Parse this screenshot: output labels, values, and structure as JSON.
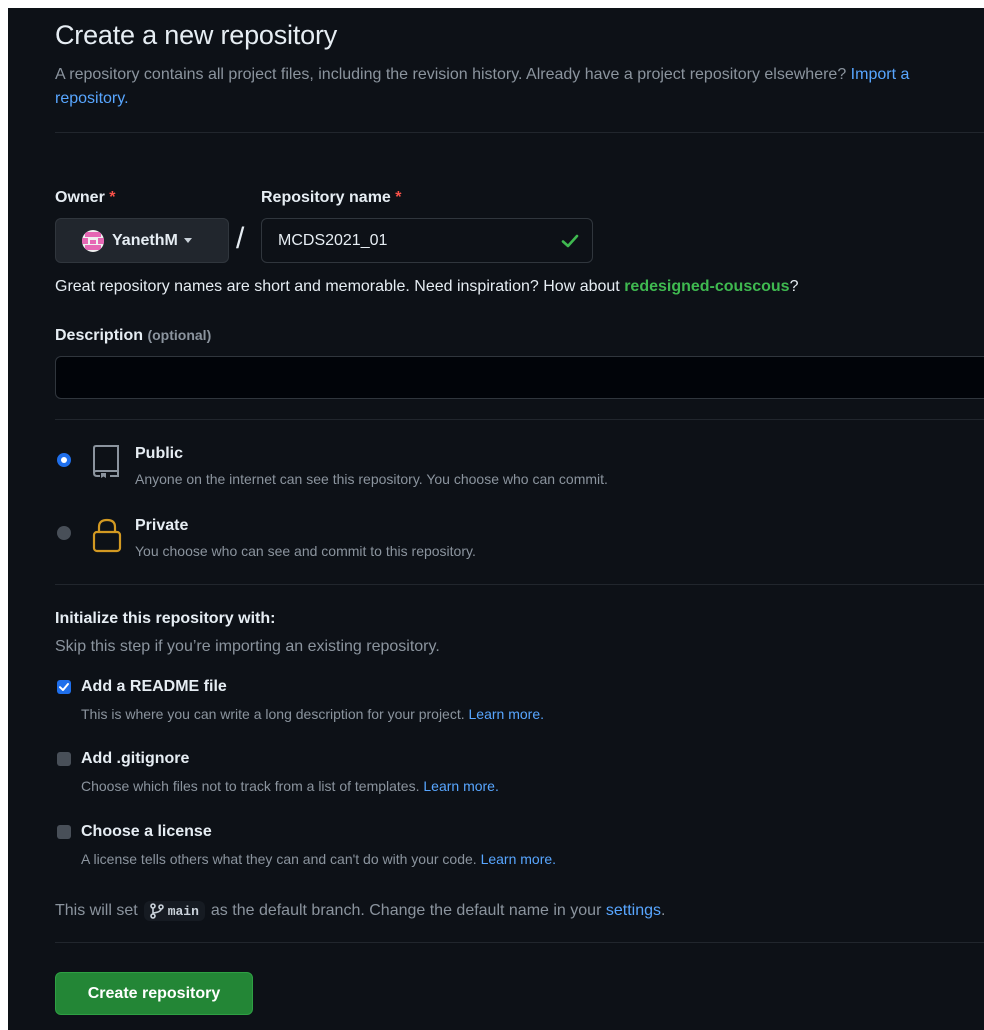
{
  "header": {
    "title": "Create a new repository",
    "subtitle": "A repository contains all project files, including the revision history. Already have a project repository elsewhere?",
    "import_link": "Import a repository."
  },
  "owner": {
    "label": "Owner",
    "required_mark": "*",
    "value": "YanethM"
  },
  "separator": "/",
  "repo_name": {
    "label": "Repository name",
    "required_mark": "*",
    "value": "MCDS2021_01"
  },
  "hint": {
    "text": "Great repository names are short and memorable. Need inspiration? How about",
    "suggestion": "redesigned-couscous",
    "suffix": "?"
  },
  "description": {
    "label": "Description",
    "optional": "(optional)",
    "value": ""
  },
  "visibility": {
    "public": {
      "title": "Public",
      "desc": "Anyone on the internet can see this repository. You choose who can commit.",
      "selected": true
    },
    "private": {
      "title": "Private",
      "desc": "You choose who can see and commit to this repository.",
      "selected": false
    }
  },
  "init": {
    "title": "Initialize this repository with:",
    "subtitle": "Skip this step if you’re importing an existing repository.",
    "readme": {
      "title": "Add a README file",
      "desc": "This is where you can write a long description for your project.",
      "link": "Learn more.",
      "checked": true
    },
    "gitignore": {
      "title": "Add .gitignore",
      "desc": "Choose which files not to track from a list of templates.",
      "link": "Learn more.",
      "checked": false
    },
    "license": {
      "title": "Choose a license",
      "desc": "A license tells others what they can and can't do with your code.",
      "link": "Learn more.",
      "checked": false
    }
  },
  "branch": {
    "prefix": "This will set",
    "name": "main",
    "middle": "as the default branch. Change the default name in your",
    "link": "settings",
    "suffix": "."
  },
  "submit": {
    "label": "Create repository"
  },
  "colors": {
    "background": "#0d1117",
    "accent": "#58a6ff",
    "success": "#3fb950",
    "danger": "#f85149",
    "button": "#238636",
    "lock": "#d29922"
  }
}
